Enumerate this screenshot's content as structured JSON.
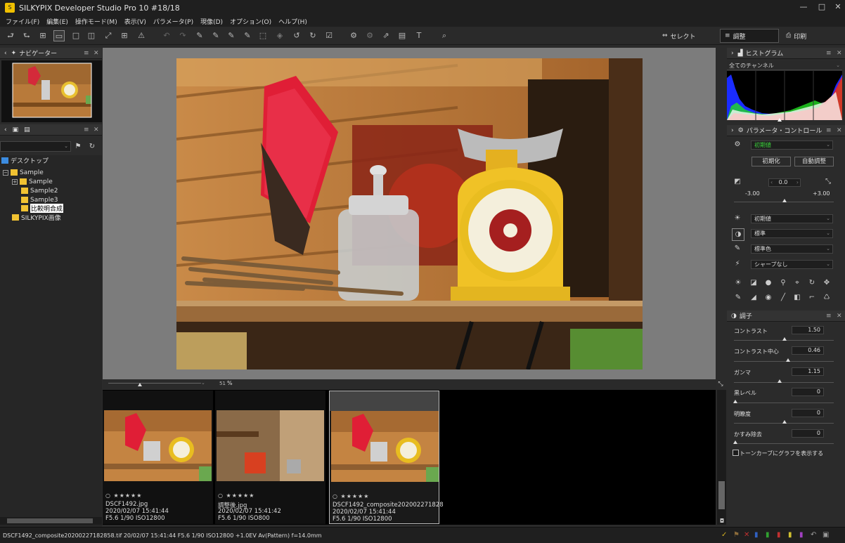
{
  "window": {
    "title": "SILKYPIX Developer Studio Pro 10 #18/18",
    "minimize": "—",
    "maximize": "□",
    "close": "✕"
  },
  "menu": [
    "ファイル(F)",
    "編集(E)",
    "操作モード(M)",
    "表示(V)",
    "パラメータ(P)",
    "現像(D)",
    "オプション(O)",
    "ヘルプ(H)"
  ],
  "modes": {
    "select": "セレクト",
    "adjust": "調整",
    "print": "印刷"
  },
  "navigator": {
    "title": "ナビゲーター"
  },
  "folder_panel": {
    "desktop": "デスクトップ",
    "tree": [
      "Sample",
      "Sample",
      "Sample2",
      "Sample3",
      "比較明合成",
      "SILKYPIX画像"
    ]
  },
  "preview": {
    "zoom": "51",
    "zoom_unit": "%"
  },
  "thumbnails": [
    {
      "stars": "○ ★★★★★",
      "name": "DSCF1492.jpg",
      "date": "2020/02/07 15:41:44",
      "exif": "F5.6 1/90 ISO12800"
    },
    {
      "stars": "○ ★★★★★",
      "name": "調整後.jpg",
      "date": "2020/02/07 15:41:42",
      "exif": "F5.6 1/90 ISO800"
    },
    {
      "stars": "○ ★★★★★",
      "name": "DSCF1492_composite202002271828",
      "date": "2020/02/07 15:41:44",
      "exif": "F5.6 1/90 ISO12800"
    }
  ],
  "histogram": {
    "title": "ヒストグラム",
    "channel": "全てのチャンネル"
  },
  "param_control": {
    "title": "パラメータ・コントロール",
    "preset": "初期値",
    "init_btn": "初期化",
    "auto_btn": "自動調整",
    "exposure": {
      "value": "0.0",
      "min": "-3.00",
      "max": "+3.00"
    },
    "wb": "初期値",
    "tone": "標準",
    "color": "標準色",
    "sharp": "シャープなし"
  },
  "tone_panel": {
    "title": "調子",
    "rows": [
      {
        "label": "コントラスト",
        "value": "1.50"
      },
      {
        "label": "コントラスト中心",
        "value": "0.46"
      },
      {
        "label": "ガンマ",
        "value": "1.15"
      },
      {
        "label": "黒レベル",
        "value": "0"
      },
      {
        "label": "明瞭度",
        "value": "0"
      },
      {
        "label": "かすみ除去",
        "value": "0"
      }
    ],
    "tone_curve_label": "トーンカーブにグラフを表示する"
  },
  "status": {
    "text": "DSCF1492_composite20200227182858.tif 20/02/07 15:41:44 F5.6 1/90 ISO12800 +1.0EV Av(Pattern) f=14.0mm"
  }
}
